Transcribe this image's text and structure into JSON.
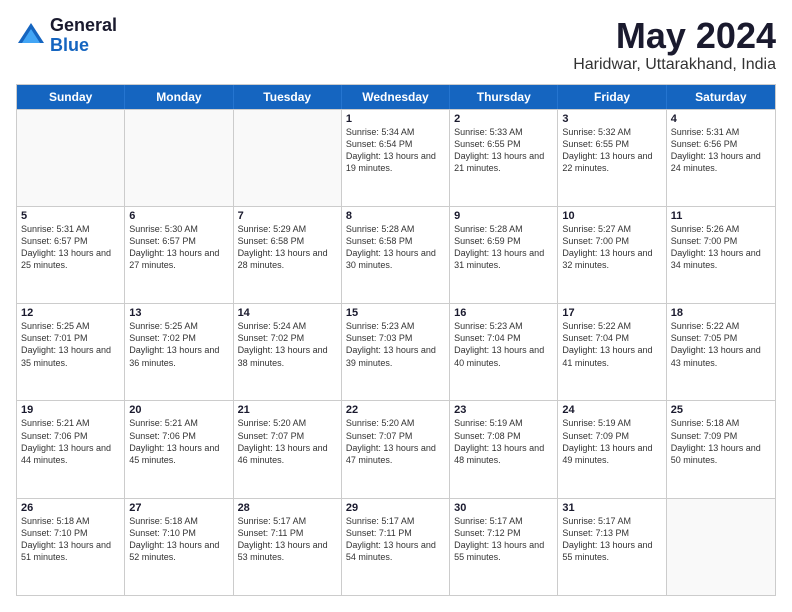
{
  "logo": {
    "general": "General",
    "blue": "Blue"
  },
  "title": "May 2024",
  "subtitle": "Haridwar, Uttarakhand, India",
  "weekdays": [
    "Sunday",
    "Monday",
    "Tuesday",
    "Wednesday",
    "Thursday",
    "Friday",
    "Saturday"
  ],
  "weeks": [
    [
      {
        "day": "",
        "sunrise": "",
        "sunset": "",
        "daylight": "",
        "empty": true
      },
      {
        "day": "",
        "sunrise": "",
        "sunset": "",
        "daylight": "",
        "empty": true
      },
      {
        "day": "",
        "sunrise": "",
        "sunset": "",
        "daylight": "",
        "empty": true
      },
      {
        "day": "1",
        "sunrise": "Sunrise: 5:34 AM",
        "sunset": "Sunset: 6:54 PM",
        "daylight": "Daylight: 13 hours and 19 minutes.",
        "empty": false
      },
      {
        "day": "2",
        "sunrise": "Sunrise: 5:33 AM",
        "sunset": "Sunset: 6:55 PM",
        "daylight": "Daylight: 13 hours and 21 minutes.",
        "empty": false
      },
      {
        "day": "3",
        "sunrise": "Sunrise: 5:32 AM",
        "sunset": "Sunset: 6:55 PM",
        "daylight": "Daylight: 13 hours and 22 minutes.",
        "empty": false
      },
      {
        "day": "4",
        "sunrise": "Sunrise: 5:31 AM",
        "sunset": "Sunset: 6:56 PM",
        "daylight": "Daylight: 13 hours and 24 minutes.",
        "empty": false
      }
    ],
    [
      {
        "day": "5",
        "sunrise": "Sunrise: 5:31 AM",
        "sunset": "Sunset: 6:57 PM",
        "daylight": "Daylight: 13 hours and 25 minutes.",
        "empty": false
      },
      {
        "day": "6",
        "sunrise": "Sunrise: 5:30 AM",
        "sunset": "Sunset: 6:57 PM",
        "daylight": "Daylight: 13 hours and 27 minutes.",
        "empty": false
      },
      {
        "day": "7",
        "sunrise": "Sunrise: 5:29 AM",
        "sunset": "Sunset: 6:58 PM",
        "daylight": "Daylight: 13 hours and 28 minutes.",
        "empty": false
      },
      {
        "day": "8",
        "sunrise": "Sunrise: 5:28 AM",
        "sunset": "Sunset: 6:58 PM",
        "daylight": "Daylight: 13 hours and 30 minutes.",
        "empty": false
      },
      {
        "day": "9",
        "sunrise": "Sunrise: 5:28 AM",
        "sunset": "Sunset: 6:59 PM",
        "daylight": "Daylight: 13 hours and 31 minutes.",
        "empty": false
      },
      {
        "day": "10",
        "sunrise": "Sunrise: 5:27 AM",
        "sunset": "Sunset: 7:00 PM",
        "daylight": "Daylight: 13 hours and 32 minutes.",
        "empty": false
      },
      {
        "day": "11",
        "sunrise": "Sunrise: 5:26 AM",
        "sunset": "Sunset: 7:00 PM",
        "daylight": "Daylight: 13 hours and 34 minutes.",
        "empty": false
      }
    ],
    [
      {
        "day": "12",
        "sunrise": "Sunrise: 5:25 AM",
        "sunset": "Sunset: 7:01 PM",
        "daylight": "Daylight: 13 hours and 35 minutes.",
        "empty": false
      },
      {
        "day": "13",
        "sunrise": "Sunrise: 5:25 AM",
        "sunset": "Sunset: 7:02 PM",
        "daylight": "Daylight: 13 hours and 36 minutes.",
        "empty": false
      },
      {
        "day": "14",
        "sunrise": "Sunrise: 5:24 AM",
        "sunset": "Sunset: 7:02 PM",
        "daylight": "Daylight: 13 hours and 38 minutes.",
        "empty": false
      },
      {
        "day": "15",
        "sunrise": "Sunrise: 5:23 AM",
        "sunset": "Sunset: 7:03 PM",
        "daylight": "Daylight: 13 hours and 39 minutes.",
        "empty": false
      },
      {
        "day": "16",
        "sunrise": "Sunrise: 5:23 AM",
        "sunset": "Sunset: 7:04 PM",
        "daylight": "Daylight: 13 hours and 40 minutes.",
        "empty": false
      },
      {
        "day": "17",
        "sunrise": "Sunrise: 5:22 AM",
        "sunset": "Sunset: 7:04 PM",
        "daylight": "Daylight: 13 hours and 41 minutes.",
        "empty": false
      },
      {
        "day": "18",
        "sunrise": "Sunrise: 5:22 AM",
        "sunset": "Sunset: 7:05 PM",
        "daylight": "Daylight: 13 hours and 43 minutes.",
        "empty": false
      }
    ],
    [
      {
        "day": "19",
        "sunrise": "Sunrise: 5:21 AM",
        "sunset": "Sunset: 7:06 PM",
        "daylight": "Daylight: 13 hours and 44 minutes.",
        "empty": false
      },
      {
        "day": "20",
        "sunrise": "Sunrise: 5:21 AM",
        "sunset": "Sunset: 7:06 PM",
        "daylight": "Daylight: 13 hours and 45 minutes.",
        "empty": false
      },
      {
        "day": "21",
        "sunrise": "Sunrise: 5:20 AM",
        "sunset": "Sunset: 7:07 PM",
        "daylight": "Daylight: 13 hours and 46 minutes.",
        "empty": false
      },
      {
        "day": "22",
        "sunrise": "Sunrise: 5:20 AM",
        "sunset": "Sunset: 7:07 PM",
        "daylight": "Daylight: 13 hours and 47 minutes.",
        "empty": false
      },
      {
        "day": "23",
        "sunrise": "Sunrise: 5:19 AM",
        "sunset": "Sunset: 7:08 PM",
        "daylight": "Daylight: 13 hours and 48 minutes.",
        "empty": false
      },
      {
        "day": "24",
        "sunrise": "Sunrise: 5:19 AM",
        "sunset": "Sunset: 7:09 PM",
        "daylight": "Daylight: 13 hours and 49 minutes.",
        "empty": false
      },
      {
        "day": "25",
        "sunrise": "Sunrise: 5:18 AM",
        "sunset": "Sunset: 7:09 PM",
        "daylight": "Daylight: 13 hours and 50 minutes.",
        "empty": false
      }
    ],
    [
      {
        "day": "26",
        "sunrise": "Sunrise: 5:18 AM",
        "sunset": "Sunset: 7:10 PM",
        "daylight": "Daylight: 13 hours and 51 minutes.",
        "empty": false
      },
      {
        "day": "27",
        "sunrise": "Sunrise: 5:18 AM",
        "sunset": "Sunset: 7:10 PM",
        "daylight": "Daylight: 13 hours and 52 minutes.",
        "empty": false
      },
      {
        "day": "28",
        "sunrise": "Sunrise: 5:17 AM",
        "sunset": "Sunset: 7:11 PM",
        "daylight": "Daylight: 13 hours and 53 minutes.",
        "empty": false
      },
      {
        "day": "29",
        "sunrise": "Sunrise: 5:17 AM",
        "sunset": "Sunset: 7:11 PM",
        "daylight": "Daylight: 13 hours and 54 minutes.",
        "empty": false
      },
      {
        "day": "30",
        "sunrise": "Sunrise: 5:17 AM",
        "sunset": "Sunset: 7:12 PM",
        "daylight": "Daylight: 13 hours and 55 minutes.",
        "empty": false
      },
      {
        "day": "31",
        "sunrise": "Sunrise: 5:17 AM",
        "sunset": "Sunset: 7:13 PM",
        "daylight": "Daylight: 13 hours and 55 minutes.",
        "empty": false
      },
      {
        "day": "",
        "sunrise": "",
        "sunset": "",
        "daylight": "",
        "empty": true
      }
    ]
  ]
}
